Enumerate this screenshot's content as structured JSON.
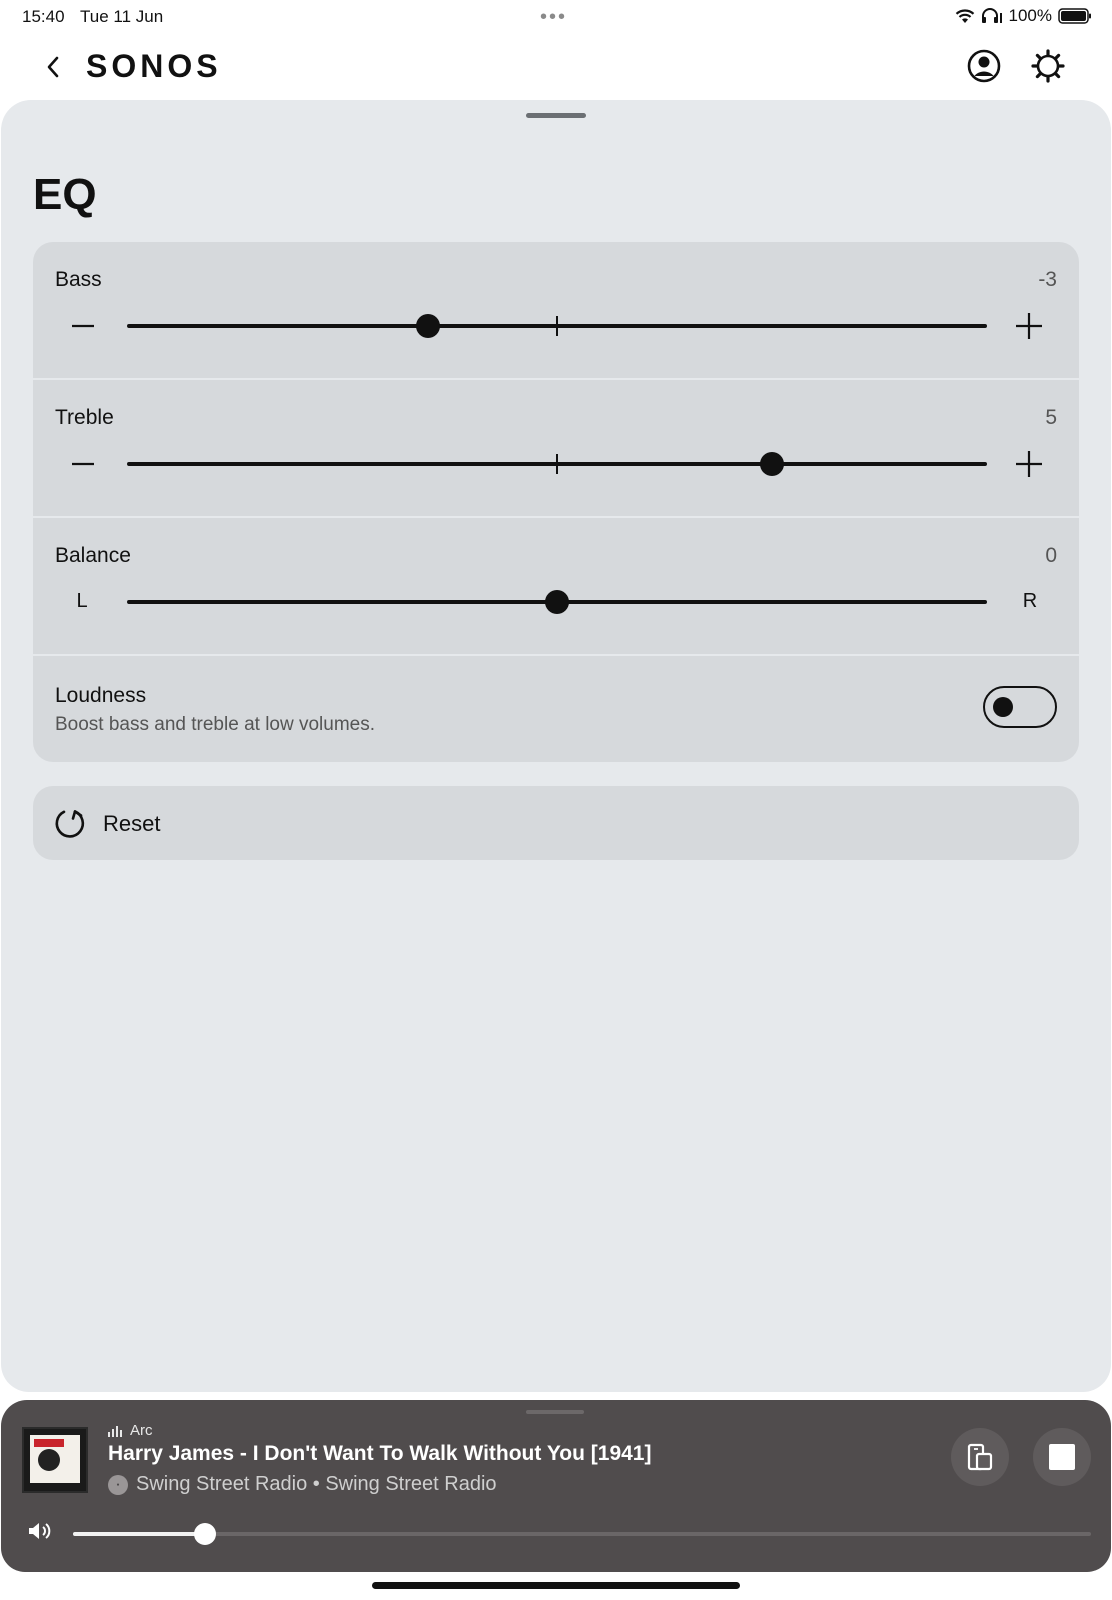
{
  "status_bar": {
    "time": "15:40",
    "date": "Tue 11 Jun",
    "more_dots": "•••",
    "battery": "100%",
    "icons": [
      "wifi-icon",
      "headphones-icon",
      "battery-icon"
    ]
  },
  "header": {
    "brand": "SONOS",
    "back_icon": "chevron-left-icon",
    "account_icon": "account-circle-icon",
    "settings_icon": "gear-icon"
  },
  "page": {
    "title": "EQ"
  },
  "eq": {
    "bass": {
      "label": "Bass",
      "value": "-3",
      "position": 0.35,
      "min_icon": "minus-icon",
      "max_icon": "plus-icon"
    },
    "treble": {
      "label": "Treble",
      "value": "5",
      "position": 0.75,
      "min_icon": "minus-icon",
      "max_icon": "plus-icon"
    },
    "balance": {
      "label": "Balance",
      "value": "0",
      "position": 0.5,
      "left_label": "L",
      "right_label": "R"
    },
    "loudness": {
      "label": "Loudness",
      "description": "Boost bass and treble at low volumes.",
      "enabled": false
    }
  },
  "reset": {
    "label": "Reset",
    "icon": "reset-icon"
  },
  "player": {
    "room": "Arc",
    "track_title": "Harry James - I Don't Want To Walk Without You [1941]",
    "source": "Swing Street Radio • Swing Street Radio",
    "volume_fraction": 0.13,
    "icons": [
      "equalizer-icon",
      "group-icon",
      "stop-icon",
      "volume-icon"
    ]
  },
  "colors": {
    "sheet_bg": "#e6e9ec",
    "card_bg": "#d6d9dc",
    "player_bg": "#504c4d",
    "text": "#111111"
  }
}
